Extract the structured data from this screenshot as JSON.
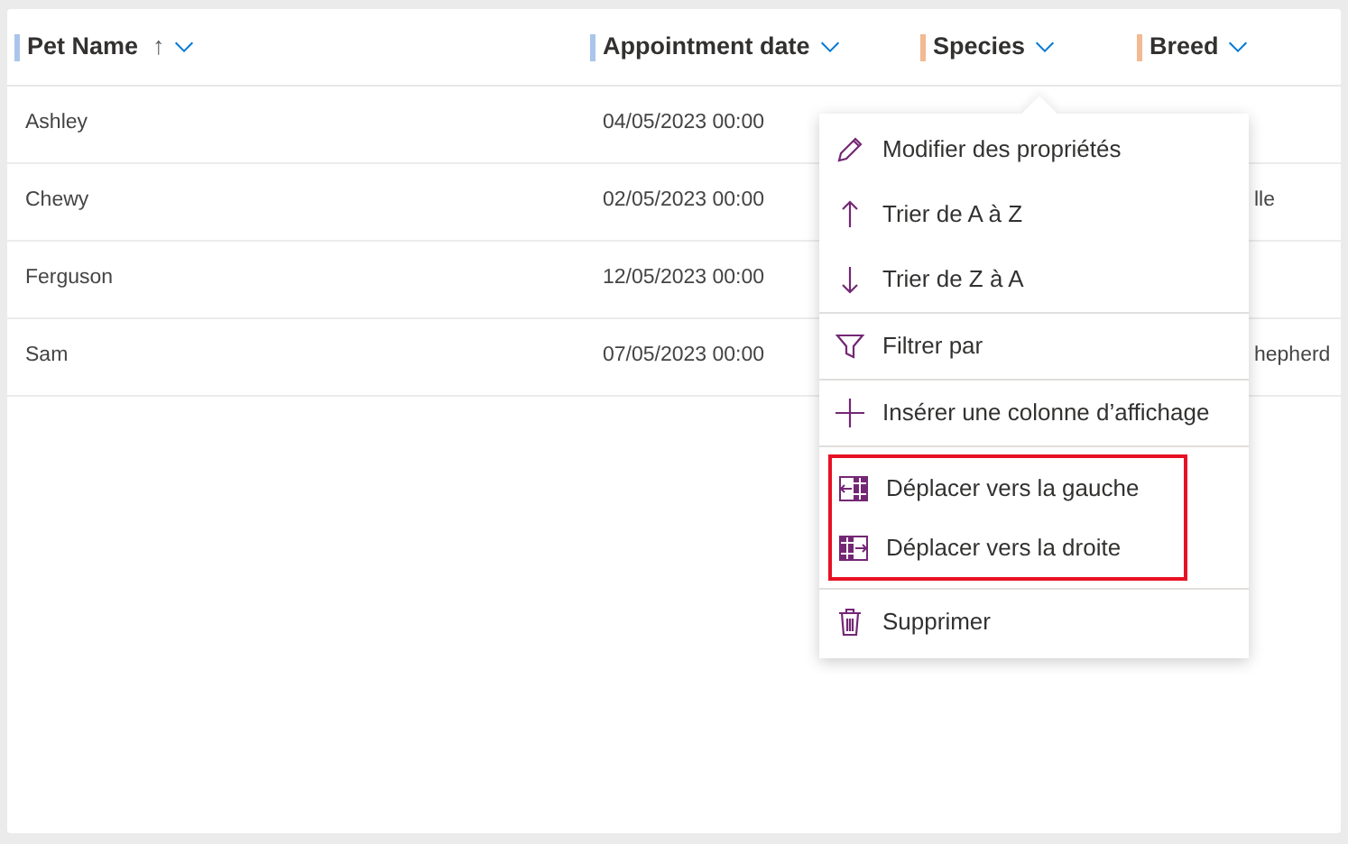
{
  "table": {
    "columns": [
      {
        "label": "Pet Name",
        "color": "#a9c5ec",
        "sort_arrow": "↑"
      },
      {
        "label": "Appointment date",
        "color": "#a9c5ec"
      },
      {
        "label": "Species",
        "color": "#f2b992"
      },
      {
        "label": "Breed",
        "color": "#f2b992"
      }
    ],
    "rows": [
      {
        "cells": [
          "Ashley",
          "04/05/2023 00:00",
          "",
          ""
        ]
      },
      {
        "cells": [
          "Chewy",
          "02/05/2023 00:00",
          "",
          "lle"
        ]
      },
      {
        "cells": [
          "Ferguson",
          "12/05/2023 00:00",
          "",
          ""
        ]
      },
      {
        "cells": [
          "Sam",
          "07/05/2023 00:00",
          "",
          "hepherd"
        ]
      }
    ]
  },
  "column_menu": {
    "groups": [
      {
        "highlighted": false,
        "items": [
          {
            "kind": "edit",
            "label": "Modifier des propriétés"
          },
          {
            "kind": "sort-up",
            "label": "Trier de A à Z"
          },
          {
            "kind": "sort-down",
            "label": "Trier de Z à A"
          }
        ]
      },
      {
        "highlighted": false,
        "items": [
          {
            "kind": "filter",
            "label": "Filtrer par"
          }
        ]
      },
      {
        "highlighted": false,
        "items": [
          {
            "kind": "add",
            "label": "Insérer une colonne d’affichage"
          }
        ]
      },
      {
        "highlighted": true,
        "items": [
          {
            "kind": "move-left",
            "label": "Déplacer vers la gauche"
          },
          {
            "kind": "move-right",
            "label": "Déplacer vers la droite"
          }
        ]
      },
      {
        "highlighted": false,
        "items": [
          {
            "kind": "delete",
            "label": "Supprimer"
          }
        ]
      }
    ]
  }
}
